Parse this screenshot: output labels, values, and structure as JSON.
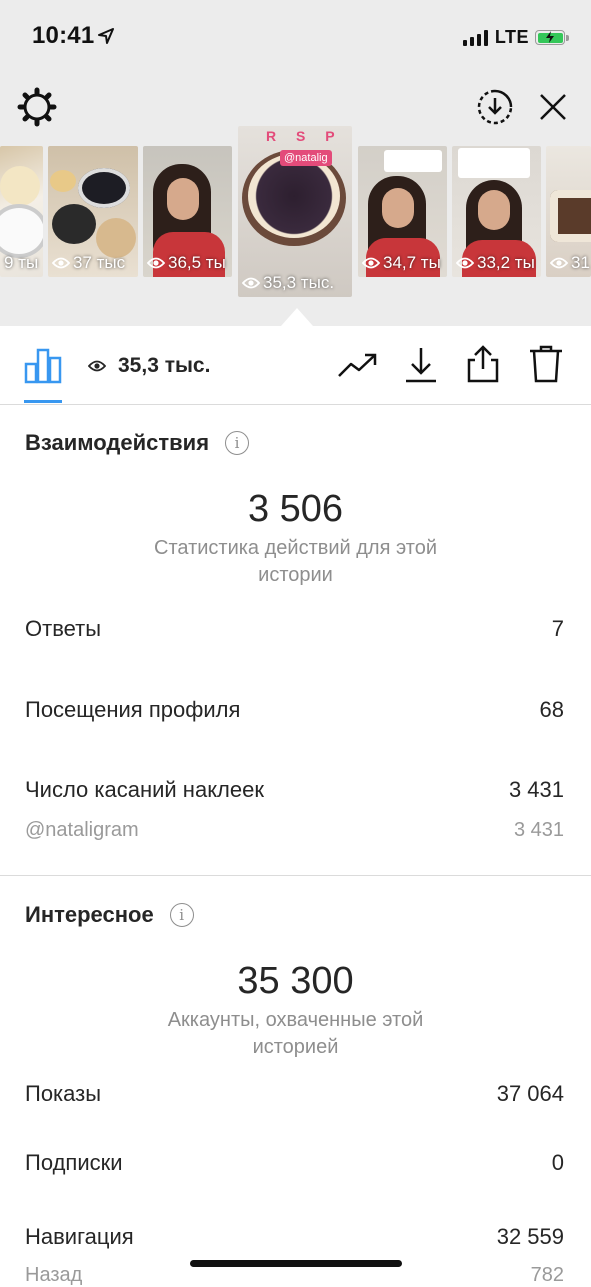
{
  "status_bar": {
    "time": "10:41",
    "network": "LTE"
  },
  "thumbnails": [
    {
      "views": "9 ты"
    },
    {
      "views": "37 тыс"
    },
    {
      "views": "36,5 ты"
    },
    {
      "views": "35,3 тыс.",
      "tag": "@natalig"
    },
    {
      "views": "34,7 ты"
    },
    {
      "views": "33,2 ты"
    },
    {
      "views": "31"
    }
  ],
  "toolbar": {
    "views": "35,3 тыс."
  },
  "interactions": {
    "title": "Взаимодействия",
    "total": "3 506",
    "caption": "Статистика действий для этой истории",
    "rows": [
      {
        "label": "Ответы",
        "value": "7"
      },
      {
        "label": "Посещения профиля",
        "value": "68"
      },
      {
        "label": "Число касаний наклеек",
        "value": "3 431"
      }
    ],
    "sub_row": {
      "label": "@nataligram",
      "value": "3 431"
    }
  },
  "discovery": {
    "title": "Интересное",
    "total": "35 300",
    "caption": "Аккаунты, охваченные этой историей",
    "rows": [
      {
        "label": "Показы",
        "value": "37 064"
      },
      {
        "label": "Подписки",
        "value": "0"
      },
      {
        "label": "Навигация",
        "value": "32 559"
      }
    ],
    "sub_row": {
      "label": "Назад",
      "value": "782"
    }
  }
}
